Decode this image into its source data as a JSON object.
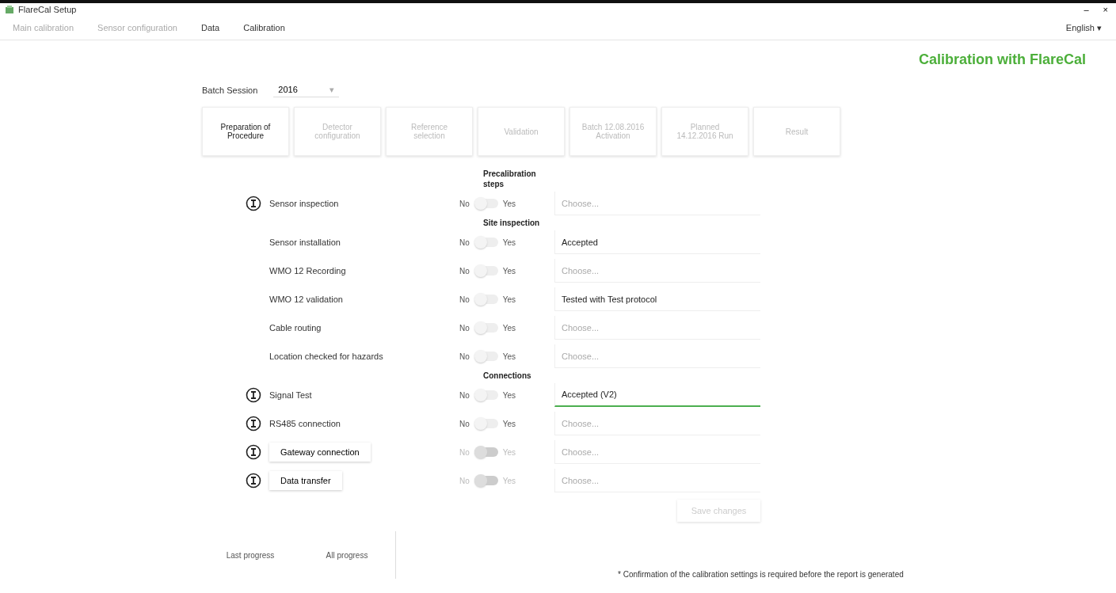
{
  "window": {
    "title": "FlareCal Setup"
  },
  "menu": [
    {
      "label": "Main calibration",
      "disabled": true
    },
    {
      "label": "Sensor configuration",
      "disabled": true
    },
    {
      "label": "Data",
      "disabled": false
    },
    {
      "label": "Calibration",
      "disabled": false
    }
  ],
  "language": {
    "value": "English",
    "caret": "▾"
  },
  "window_controls": [
    "–",
    "×"
  ],
  "heading": "Calibration with FlareCal",
  "batch": {
    "label": "Batch Session",
    "value": "2016",
    "caret": "▾"
  },
  "steps": [
    {
      "label": "Preparation of Procedure",
      "selected": true
    },
    {
      "label": "Detector configuration",
      "selected": false
    },
    {
      "label": "Reference selection",
      "selected": false
    },
    {
      "label": "Validation",
      "selected": false
    },
    {
      "label": "Batch 12.08.2016 Activation",
      "selected": false
    },
    {
      "label": "Planned 14.12.2016 Run",
      "selected": false
    },
    {
      "label": "Result",
      "selected": false
    }
  ],
  "sections": [
    {
      "title": "Precalibration steps",
      "rows": [
        {
          "kind": "label",
          "info": true,
          "label": "Sensor inspection",
          "no": "No",
          "yes": "Yes",
          "on": false,
          "disabled": false,
          "field": {
            "placeholder": "Choose..."
          },
          "focused": false
        }
      ]
    },
    {
      "title": "Site inspection",
      "rows": [
        {
          "kind": "label",
          "info": false,
          "label": "Sensor installation",
          "no": "No",
          "yes": "Yes",
          "on": false,
          "disabled": false,
          "field": {
            "value": "Accepted"
          },
          "focused": false
        },
        {
          "kind": "label",
          "info": false,
          "label": "WMO 12 Recording",
          "no": "No",
          "yes": "Yes",
          "on": false,
          "disabled": false,
          "field": {
            "placeholder": "Choose..."
          },
          "focused": false
        },
        {
          "kind": "label",
          "info": false,
          "label": "WMO 12 validation",
          "no": "No",
          "yes": "Yes",
          "on": false,
          "disabled": false,
          "field": {
            "value": "Tested with Test protocol"
          },
          "focused": false
        },
        {
          "kind": "label",
          "info": false,
          "label": "Cable routing",
          "no": "No",
          "yes": "Yes",
          "on": false,
          "disabled": false,
          "field": {
            "placeholder": "Choose..."
          },
          "focused": false
        },
        {
          "kind": "label",
          "info": false,
          "label": "Location checked for hazards",
          "no": "No",
          "yes": "Yes",
          "on": false,
          "disabled": false,
          "field": {
            "placeholder": "Choose..."
          },
          "focused": false
        }
      ]
    },
    {
      "title": "Connections",
      "rows": [
        {
          "kind": "label",
          "info": true,
          "label": "Signal Test",
          "no": "No",
          "yes": "Yes",
          "on": false,
          "disabled": false,
          "field": {
            "value": "Accepted (V2)"
          },
          "focused": true
        },
        {
          "kind": "label",
          "info": true,
          "label": "RS485 connection",
          "no": "No",
          "yes": "Yes",
          "on": false,
          "disabled": false,
          "field": {
            "placeholder": "Choose..."
          },
          "focused": false
        },
        {
          "kind": "button",
          "info": true,
          "label": "Gateway connection",
          "no": "No",
          "yes": "Yes",
          "on": false,
          "disabled": true,
          "field": {
            "placeholder": "Choose..."
          },
          "focused": false
        },
        {
          "kind": "button",
          "info": true,
          "label": "Data transfer",
          "no": "No",
          "yes": "Yes",
          "on": false,
          "disabled": true,
          "field": {
            "placeholder": "Choose..."
          },
          "focused": false
        }
      ]
    }
  ],
  "save_button": {
    "label": "Save changes",
    "disabled": true
  },
  "bottom_tabs": [
    {
      "label": "Last progress",
      "selected": false
    },
    {
      "label": "All progress",
      "selected": false
    }
  ],
  "footnote": "* Confirmation of the calibration settings is required before the report is generated"
}
